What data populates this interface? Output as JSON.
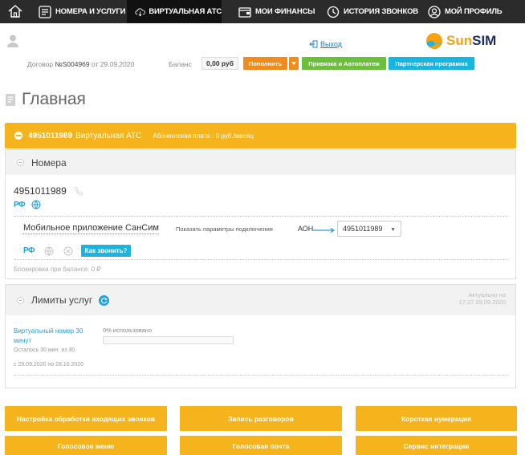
{
  "nav": {
    "items": [
      {
        "label": "НОМЕРА И УСЛУГИ",
        "icon": "list-icon"
      },
      {
        "label": "ВИРТУАЛЬНАЯ АТС",
        "icon": "cloud-icon",
        "active": true
      },
      {
        "label": "МОИ ФИНАНСЫ",
        "icon": "wallet-icon"
      },
      {
        "label": "ИСТОРИЯ ЗВОНКОВ",
        "icon": "history-icon"
      },
      {
        "label": "МОЙ ПРОФИЛЬ",
        "icon": "user-icon"
      }
    ]
  },
  "header": {
    "logout": "Выход",
    "logo_sun": "Sun",
    "logo_sim": "SIM",
    "contract_prefix": "Договор ",
    "contract_num": "№S004969",
    "contract_suffix": " от 29.09.2020",
    "balance_label": "Баланс",
    "balance_value": "0,00 руб",
    "topup": "Пополнить",
    "binding": "Привязка и Автоплатеж",
    "partner": "Партнерская программа"
  },
  "page": {
    "title": "Главная"
  },
  "vats": {
    "number": "4951011989",
    "title": "Виртуальная АТС",
    "fee": "Абонентская плата - 0 руб./месяц"
  },
  "numbers": {
    "title": "Номера",
    "number": "4951011989",
    "rd": "РФ",
    "app_title": "Мобильное приложение СанСим",
    "app_params": "Показать параметры подключения",
    "aon_label": "АОН",
    "aon_value": "4951011989",
    "how_call": "Как звонить?",
    "block": "Блокировка при балансе: 0 ₽"
  },
  "limits": {
    "title": "Лимиты услуг",
    "actual_line1": "Актуально на",
    "actual_line2": "17:27 29.09.2020",
    "item_name": "Виртуальный номер 30 минут",
    "used": "0% использовано",
    "used_fraction": 0,
    "left": "Осталось 30 мин. из 30",
    "period": "с 29.09.2020 по 28.10.2020"
  },
  "buttons": [
    "Настройка обработки входящих звонков",
    "Запись разговоров",
    "Короткая нумерация",
    "Голосовое меню",
    "Голосовая почта",
    "Сервис интеграции"
  ],
  "colors": {
    "orange": "#f6b41c",
    "accent_blue": "#1f9ee0",
    "green": "#6cbf3d",
    "topup_orange": "#f08c1e",
    "nav_bg": "#2b2b2b"
  }
}
